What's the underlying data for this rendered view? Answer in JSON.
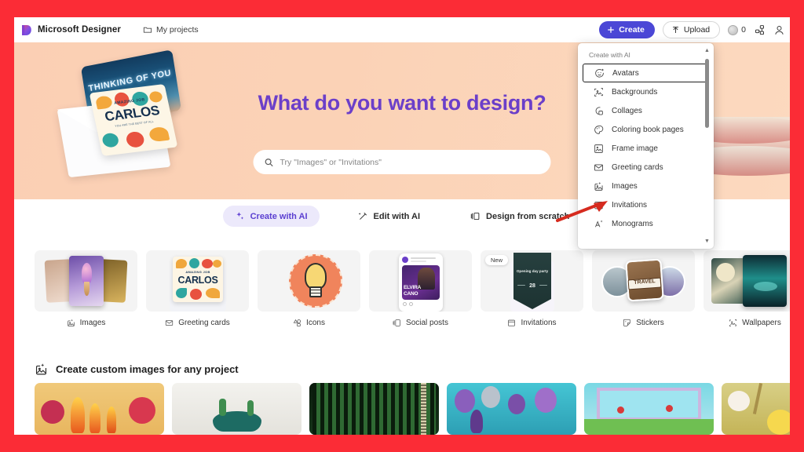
{
  "app": {
    "brand": "Microsoft Designer",
    "my_projects": "My projects",
    "accent_purple": "#4b47d6",
    "hero_bg": "#fbd2b6",
    "title_color": "#6b3fc9",
    "frame_color": "#fb2c36"
  },
  "topbar": {
    "create_label": "Create",
    "upload_label": "Upload",
    "credits_count": "0",
    "icons": {
      "folder": "folder-icon",
      "plus": "plus-icon",
      "upload": "upload-arrow-icon",
      "coin": "credits-coin-icon",
      "share": "share-icon",
      "account": "account-avatar-icon"
    }
  },
  "hero": {
    "title": "What do you want to design?",
    "search_placeholder": "Try \"Images\" or \"Invitations\"",
    "art": {
      "card1_text": "THINKING OF YOU",
      "card2_kicker": "AMAZING JOB",
      "card2_name": "CARLOS",
      "card2_sub": "YOU ARE THE BEST OF ALL"
    }
  },
  "dropdown": {
    "heading": "Create with AI",
    "selected": "Avatars",
    "items": [
      {
        "label": "Avatars",
        "icon": "avatar-smiley-icon"
      },
      {
        "label": "Backgrounds",
        "icon": "backgrounds-icon"
      },
      {
        "label": "Collages",
        "icon": "collages-icon"
      },
      {
        "label": "Coloring book pages",
        "icon": "coloring-palette-icon"
      },
      {
        "label": "Frame image",
        "icon": "frame-image-icon"
      },
      {
        "label": "Greeting cards",
        "icon": "envelope-icon"
      },
      {
        "label": "Images",
        "icon": "images-sparkle-icon"
      },
      {
        "label": "Invitations",
        "icon": "invitation-calendar-icon"
      },
      {
        "label": "Monograms",
        "icon": "monogram-icon"
      }
    ]
  },
  "modes": [
    {
      "label": "Create with AI",
      "icon": "sparkle-icon",
      "active": true
    },
    {
      "label": "Edit with AI",
      "icon": "magic-wand-icon",
      "active": false
    },
    {
      "label": "Design from scratch",
      "icon": "layout-icon",
      "active": false
    }
  ],
  "categories": [
    {
      "label": "Images",
      "icon": "images-sparkle-icon",
      "badge": ""
    },
    {
      "label": "Greeting cards",
      "icon": "envelope-icon",
      "badge": ""
    },
    {
      "label": "Icons",
      "icon": "icons-shapes-icon",
      "badge": ""
    },
    {
      "label": "Social posts",
      "icon": "social-post-icon",
      "badge": ""
    },
    {
      "label": "Invitations",
      "icon": "invitation-calendar-icon",
      "badge": "New"
    },
    {
      "label": "Stickers",
      "icon": "sticker-icon",
      "badge": ""
    },
    {
      "label": "Wallpapers",
      "icon": "wallpaper-icon",
      "badge": ""
    }
  ],
  "card_art": {
    "greeting_kicker": "AMAZING JOB",
    "greeting_name": "CARLOS",
    "social_name_1": "ELVIRA",
    "social_name_2": "CANO",
    "invite_title": "Opening day party",
    "invite_day": "28",
    "sticker_word": "TRAVEL"
  },
  "section": {
    "title": "Create custom images for any project",
    "icon": "images-sparkle-icon"
  },
  "carousel": {
    "next_icon": "chevron-right-icon"
  },
  "annotation": {
    "type": "red-arrow",
    "points_to": "Images",
    "color": "#d62b1f"
  }
}
